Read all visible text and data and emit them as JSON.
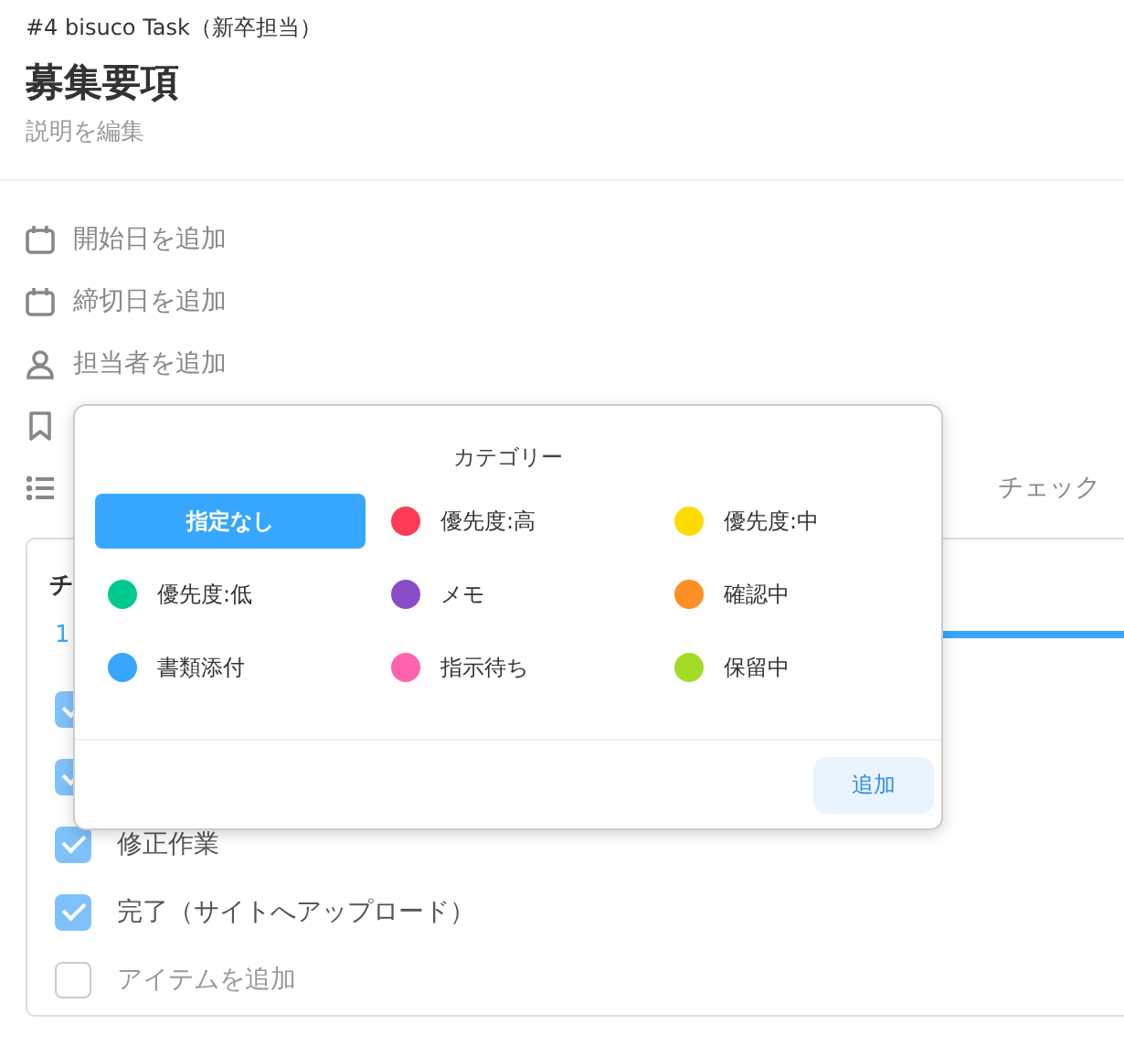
{
  "task": {
    "project": "#4 bisuco Task（新卒担当）",
    "title": "募集要項",
    "description": "説明を編集"
  },
  "properties": [
    {
      "kind": "start-date",
      "label": "開始日を追加"
    },
    {
      "kind": "due-date",
      "label": "締切日を追加"
    },
    {
      "kind": "assignee",
      "label": "担当者を追加"
    },
    {
      "kind": "category"
    },
    {
      "kind": "checklist",
      "label": "チェック"
    }
  ],
  "checklist": {
    "title": "チ",
    "progress": "1",
    "level": 1,
    "items": [
      {
        "kind": "item",
        "checked": true
      },
      {
        "kind": "item",
        "checked": true
      },
      {
        "kind": "item",
        "label": "修正作業",
        "checked": true
      },
      {
        "kind": "item",
        "label": "完了（サイトへアップロード）",
        "checked": true
      },
      {
        "kind": "add",
        "label": "アイテムを追加",
        "checked": false
      }
    ]
  },
  "category_popover": {
    "title": "カテゴリー",
    "options": [
      {
        "label": "指定なし",
        "selected": true
      },
      {
        "label": "優先度:高",
        "color": "#ff3b56",
        "selected": false
      },
      {
        "label": "優先度:中",
        "color": "#ffdb00",
        "selected": false
      },
      {
        "label": "優先度:低",
        "color": "#00c98f",
        "selected": false
      },
      {
        "label": "メモ",
        "color": "#8a4cc8",
        "selected": false
      },
      {
        "label": "確認中",
        "color": "#ff8f24",
        "selected": false
      },
      {
        "label": "書類添付",
        "color": "#36a6ff",
        "selected": false
      },
      {
        "label": "指示待ち",
        "color": "#ff63b0",
        "selected": false
      },
      {
        "label": "保留中",
        "color": "#a3dc26",
        "selected": false
      }
    ],
    "button": "追加"
  }
}
